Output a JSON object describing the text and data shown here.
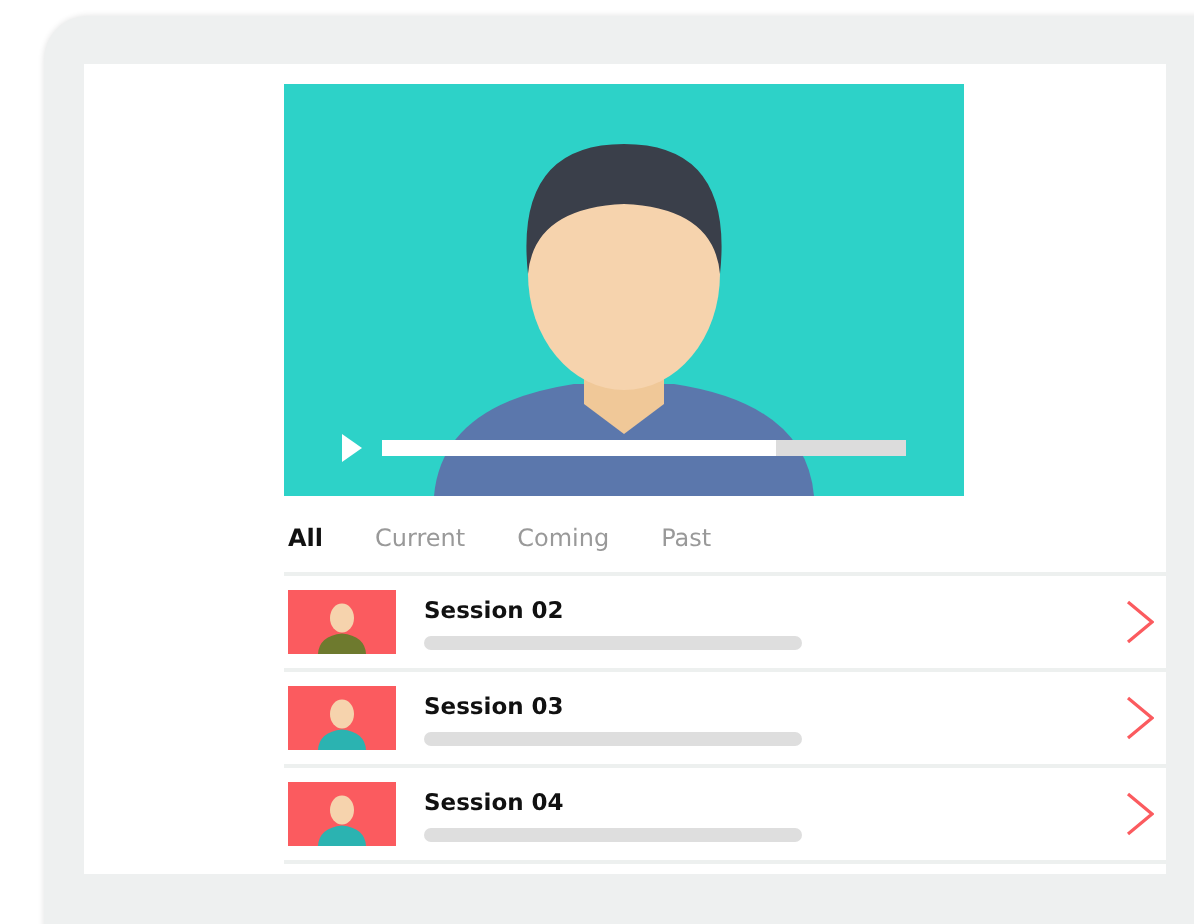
{
  "video": {
    "playing": false,
    "level": 0.75
  },
  "tabs": [
    {
      "label": "All",
      "selected": true
    },
    {
      "label": "Current",
      "selected": false
    },
    {
      "label": "Coming",
      "selected": false
    },
    {
      "label": "Past",
      "selected": false
    }
  ],
  "sessions": [
    {
      "title": "Session 02"
    },
    {
      "title": "Session 03"
    },
    {
      "title": "Session 04"
    }
  ]
}
